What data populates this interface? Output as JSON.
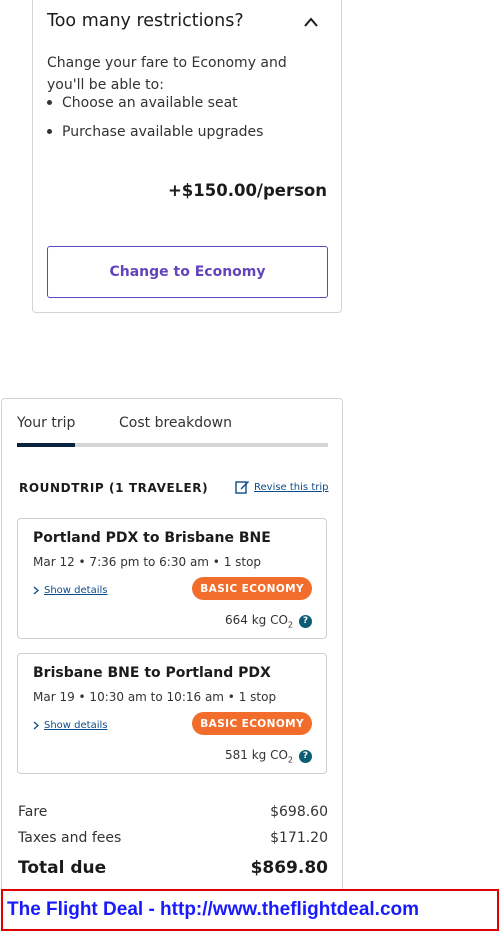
{
  "restrictions": {
    "title": "Too many restrictions?",
    "description": "Change your fare to Economy and you'll be able to:",
    "bullets": [
      "Choose an available seat",
      "Purchase available upgrades"
    ],
    "price": "+$150.00/person",
    "button_label": "Change to Economy"
  },
  "trip": {
    "tabs": [
      "Your trip",
      "Cost breakdown"
    ],
    "roundtrip_label": "ROUNDTRIP (1 TRAVELER)",
    "revise_label": "Revise this trip",
    "segments": [
      {
        "route": "Portland PDX to Brisbane BNE",
        "time": "Mar 12 • 7:36 pm to 6:30 am • 1 stop",
        "show_details": "Show details",
        "badge": "BASIC ECONOMY",
        "co2_value": "664 kg CO",
        "co2_sub": "2"
      },
      {
        "route": "Brisbane BNE to Portland PDX",
        "time": "Mar 19 • 10:30 am to 10:16 am • 1 stop",
        "show_details": "Show details",
        "badge": "BASIC ECONOMY",
        "co2_value": "581 kg CO",
        "co2_sub": "2"
      }
    ],
    "fare_label": "Fare",
    "fare_value": "$698.60",
    "taxes_label": "Taxes and fees",
    "taxes_value": "$171.20",
    "total_label": "Total due",
    "total_value": "$869.80"
  },
  "banner": {
    "text": "The Flight Deal - http://www.theflightdeal.com"
  },
  "colors": {
    "accent_purple": "#6244bb",
    "badge_orange": "#f26c2b",
    "link_blue": "#0c4c8a",
    "tab_active": "#0c2340",
    "banner_red": "#e10000",
    "banner_text": "#1a1aff"
  }
}
